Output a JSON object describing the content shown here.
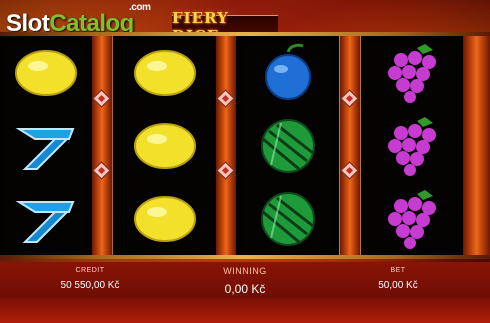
{
  "logo": {
    "part1": "Slot",
    "part2": "Catalog",
    "suffix": ".com"
  },
  "game": {
    "title": "FIERY DICE"
  },
  "reels": [
    {
      "symbols": [
        "lemon-icon",
        "sapphire-seven-icon",
        "sapphire-seven-icon"
      ]
    },
    {
      "symbols": [
        "lemon-icon",
        "lemon-icon",
        "lemon-icon"
      ]
    },
    {
      "symbols": [
        "plum-icon",
        "watermelon-icon",
        "watermelon-icon"
      ]
    },
    {
      "symbols": [
        "grapes-icon",
        "grapes-icon",
        "grapes-icon"
      ]
    }
  ],
  "stats": {
    "credit_label": "CREDIT",
    "credit_value": "50 550,00 Kč",
    "win_label": "WINNING",
    "win_value": "0,00 Kč",
    "bet_label": "BET",
    "bet_value": "50,00 Kč"
  },
  "colors": {
    "lemon": "#f2e02a",
    "plum": "#1f6fd6",
    "watermelon": "#1f9a3a",
    "grapes": "#c63bd0",
    "seven": "#1fa0e8",
    "accent": "#ffd64a"
  }
}
